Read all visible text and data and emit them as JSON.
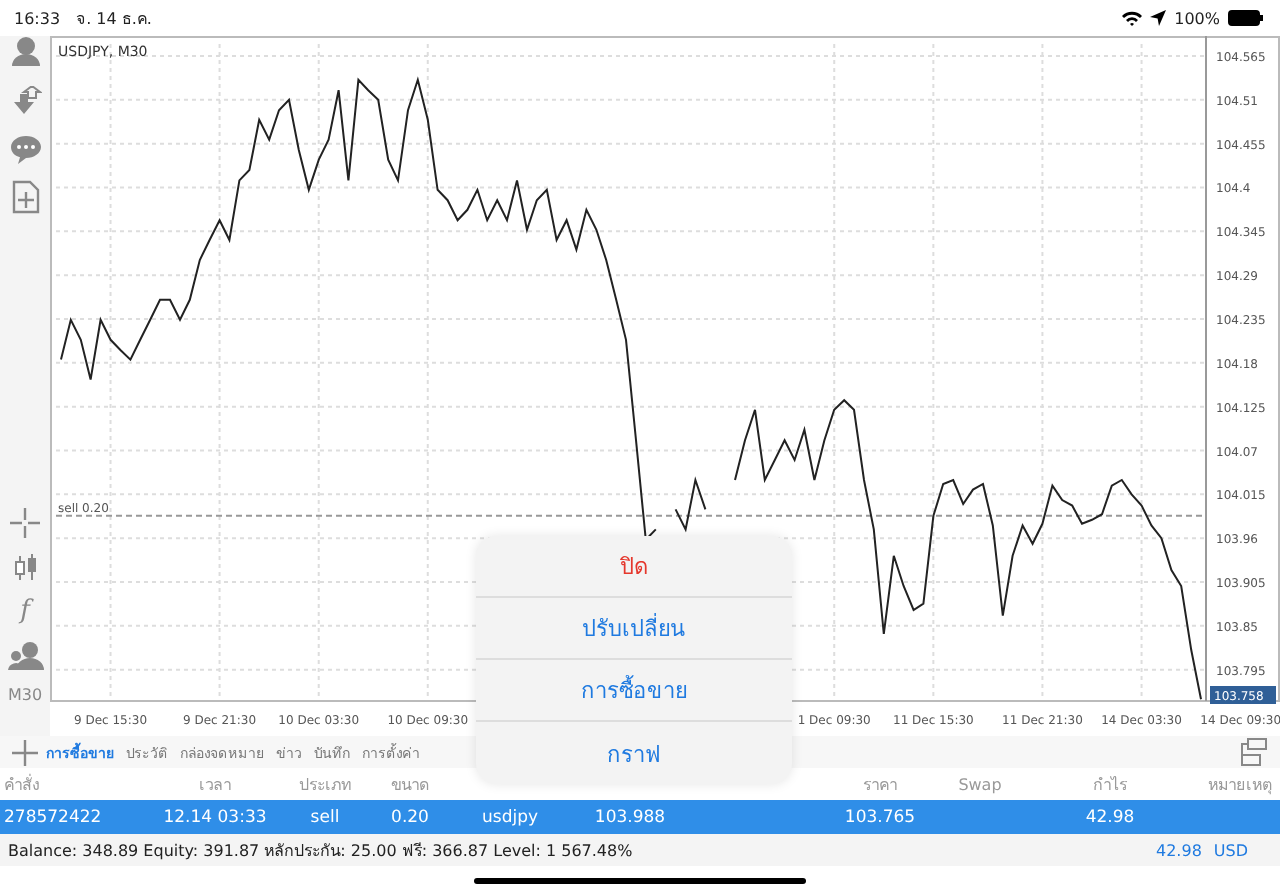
{
  "status_bar": {
    "time": "16:33",
    "date": "จ. 14 ธ.ค.",
    "battery": "100%"
  },
  "toolbar": {
    "formula_label": "f",
    "timeframe": "M30"
  },
  "chart": {
    "current_price": "103.758",
    "chart_data": {
      "type": "line",
      "title": "USDJPY, M30",
      "grid": true,
      "categories": [
        null,
        null,
        null,
        null,
        null,
        "9 Dec 15:30",
        null,
        null,
        null,
        null,
        null,
        null,
        null,
        null,
        null,
        null,
        "9 Dec 21:30",
        null,
        null,
        null,
        null,
        null,
        null,
        null,
        null,
        null,
        "10 Dec 03:30",
        null,
        null,
        null,
        null,
        null,
        null,
        null,
        null,
        null,
        null,
        "10 Dec 09:30",
        null,
        null,
        null,
        null,
        null,
        null,
        null,
        null,
        null,
        null,
        null,
        null,
        null,
        null,
        null,
        null,
        null,
        null,
        null,
        null,
        null,
        null,
        null,
        null,
        null,
        null,
        null,
        null,
        null,
        null,
        null,
        null,
        null,
        null,
        null,
        null,
        null,
        null,
        null,
        null,
        "1 Dec 09:30",
        null,
        null,
        null,
        null,
        null,
        null,
        null,
        null,
        null,
        "11 Dec 15:30",
        null,
        null,
        null,
        null,
        null,
        null,
        null,
        null,
        null,
        null,
        "11 Dec 21:30",
        null,
        null,
        null,
        null,
        null,
        null,
        null,
        null,
        null,
        "14 Dec 03:30",
        null,
        null,
        null,
        null,
        null,
        null,
        null,
        null,
        null,
        "14 Dec 09:30"
      ],
      "ylim": [
        103.757,
        104.58
      ],
      "yticks": [
        104.565,
        104.51,
        104.455,
        104.4,
        104.345,
        104.29,
        104.235,
        104.18,
        104.125,
        104.07,
        104.015,
        103.96,
        103.905,
        103.85,
        103.795
      ],
      "ref_lines": [
        {
          "axis": "y",
          "value": 103.988,
          "label": "sell 0.20"
        }
      ],
      "series": [
        {
          "color": "#222222",
          "values": [
            104.184,
            104.234,
            104.209,
            104.159,
            104.234,
            104.209,
            104.196,
            104.184,
            104.209,
            104.234,
            104.259,
            104.259,
            104.234,
            104.259,
            104.309,
            104.334,
            104.359,
            104.334,
            104.409,
            104.422,
            104.485,
            104.46,
            104.497,
            104.51,
            104.447,
            104.397,
            104.435,
            104.46,
            104.522,
            104.409,
            104.535,
            104.522,
            104.51,
            104.435,
            104.409,
            104.497,
            104.535,
            104.485,
            104.397,
            104.384,
            104.359,
            104.372,
            104.397,
            104.359,
            104.384,
            104.359,
            104.409,
            104.347,
            104.384,
            104.397,
            104.334,
            104.359,
            104.322,
            104.372,
            104.347,
            104.309,
            104.259,
            104.209,
            104.083,
            103.958,
            103.971,
            null,
            103.996,
            103.971,
            104.033,
            103.996,
            null,
            null,
            104.033,
            104.083,
            104.121,
            104.033,
            104.058,
            104.083,
            104.058,
            104.096,
            104.033,
            104.083,
            104.121,
            104.133,
            104.121,
            104.033,
            103.971,
            103.84,
            103.938,
            103.9,
            103.87,
            103.878,
            103.988,
            104.028,
            104.033,
            104.003,
            104.021,
            104.028,
            103.976,
            103.863,
            103.938,
            103.976,
            103.953,
            103.978,
            104.026,
            104.008,
            104.001,
            103.978,
            103.983,
            103.99,
            104.026,
            104.033,
            104.015,
            104.001,
            103.976,
            103.96,
            103.92,
            103.9,
            103.82,
            103.758,
            null,
            null,
            null,
            null
          ]
        }
      ]
    }
  },
  "tabs": [
    {
      "label": "การซื้อขาย",
      "selected": true
    },
    {
      "label": "ประวัติ",
      "selected": false
    },
    {
      "label": "กล่องจดหมาย",
      "selected": false
    },
    {
      "label": "ข่าว",
      "selected": false
    },
    {
      "label": "บันทึก",
      "selected": false
    },
    {
      "label": "การตั้งค่า",
      "selected": false
    }
  ],
  "table": {
    "header": {
      "order": "คำสั่ง",
      "time": "เวลา",
      "type": "ประเภท",
      "size": "ขนาด",
      "price": "ราคา",
      "swap": "Swap",
      "profit": "กำไร",
      "comment": "หมายเหตุ"
    },
    "rows": [
      {
        "selected": true,
        "order": "278572422",
        "time": "12.14 03:33",
        "type": "sell",
        "size": "0.20",
        "symbol": "usdjpy",
        "open_price": "103.988",
        "price": "103.765",
        "profit": "42.98"
      }
    ]
  },
  "summary": {
    "text": "Balance: 348.89 Equity: 391.87 หลักประกัน: 25.00 ฟรี: 366.87 Level: 1 567.48%",
    "total": "42.98",
    "currency": "USD"
  },
  "action_menu": [
    {
      "label": "ปิด",
      "kind": "destructive"
    },
    {
      "label": "ปรับเปลี่ยน",
      "kind": "normal"
    },
    {
      "label": "การซื้อขาย",
      "kind": "normal"
    },
    {
      "label": "กราฟ",
      "kind": "normal"
    }
  ]
}
